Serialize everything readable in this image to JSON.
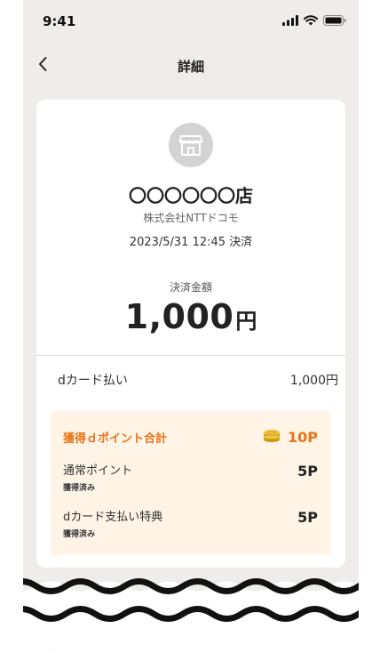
{
  "status_bar": {
    "time": "9:41"
  },
  "nav": {
    "title": "詳細"
  },
  "store": {
    "name": "〇〇〇〇〇〇店",
    "company": "株式会社NTTドコモ",
    "datetime": "2023/5/31 12:45 決済"
  },
  "payment": {
    "amount_label": "決済金額",
    "amount_value": "1,000",
    "amount_unit": "円",
    "method_label": "dカード払い",
    "method_amount": "1,000円"
  },
  "points": {
    "total_label": "獲得ｄポイント合計",
    "total_value": "10P",
    "rows": [
      {
        "label": "通常ポイント",
        "status": "獲得済み",
        "value": "5P"
      },
      {
        "label": "dカード支払い特典",
        "status": "獲得済み",
        "value": "5P"
      }
    ]
  },
  "colors": {
    "accent_orange": "#e8751a",
    "points_background": "#fff4e6",
    "screen_background": "#efedeb",
    "coin_gold": "#d9a91a"
  },
  "icons": {
    "back": "chevron-left-icon",
    "store": "storefront-icon",
    "coins": "coin-stack-icon",
    "signal": "cellular-signal-icon",
    "wifi": "wifi-icon",
    "battery": "battery-icon"
  }
}
